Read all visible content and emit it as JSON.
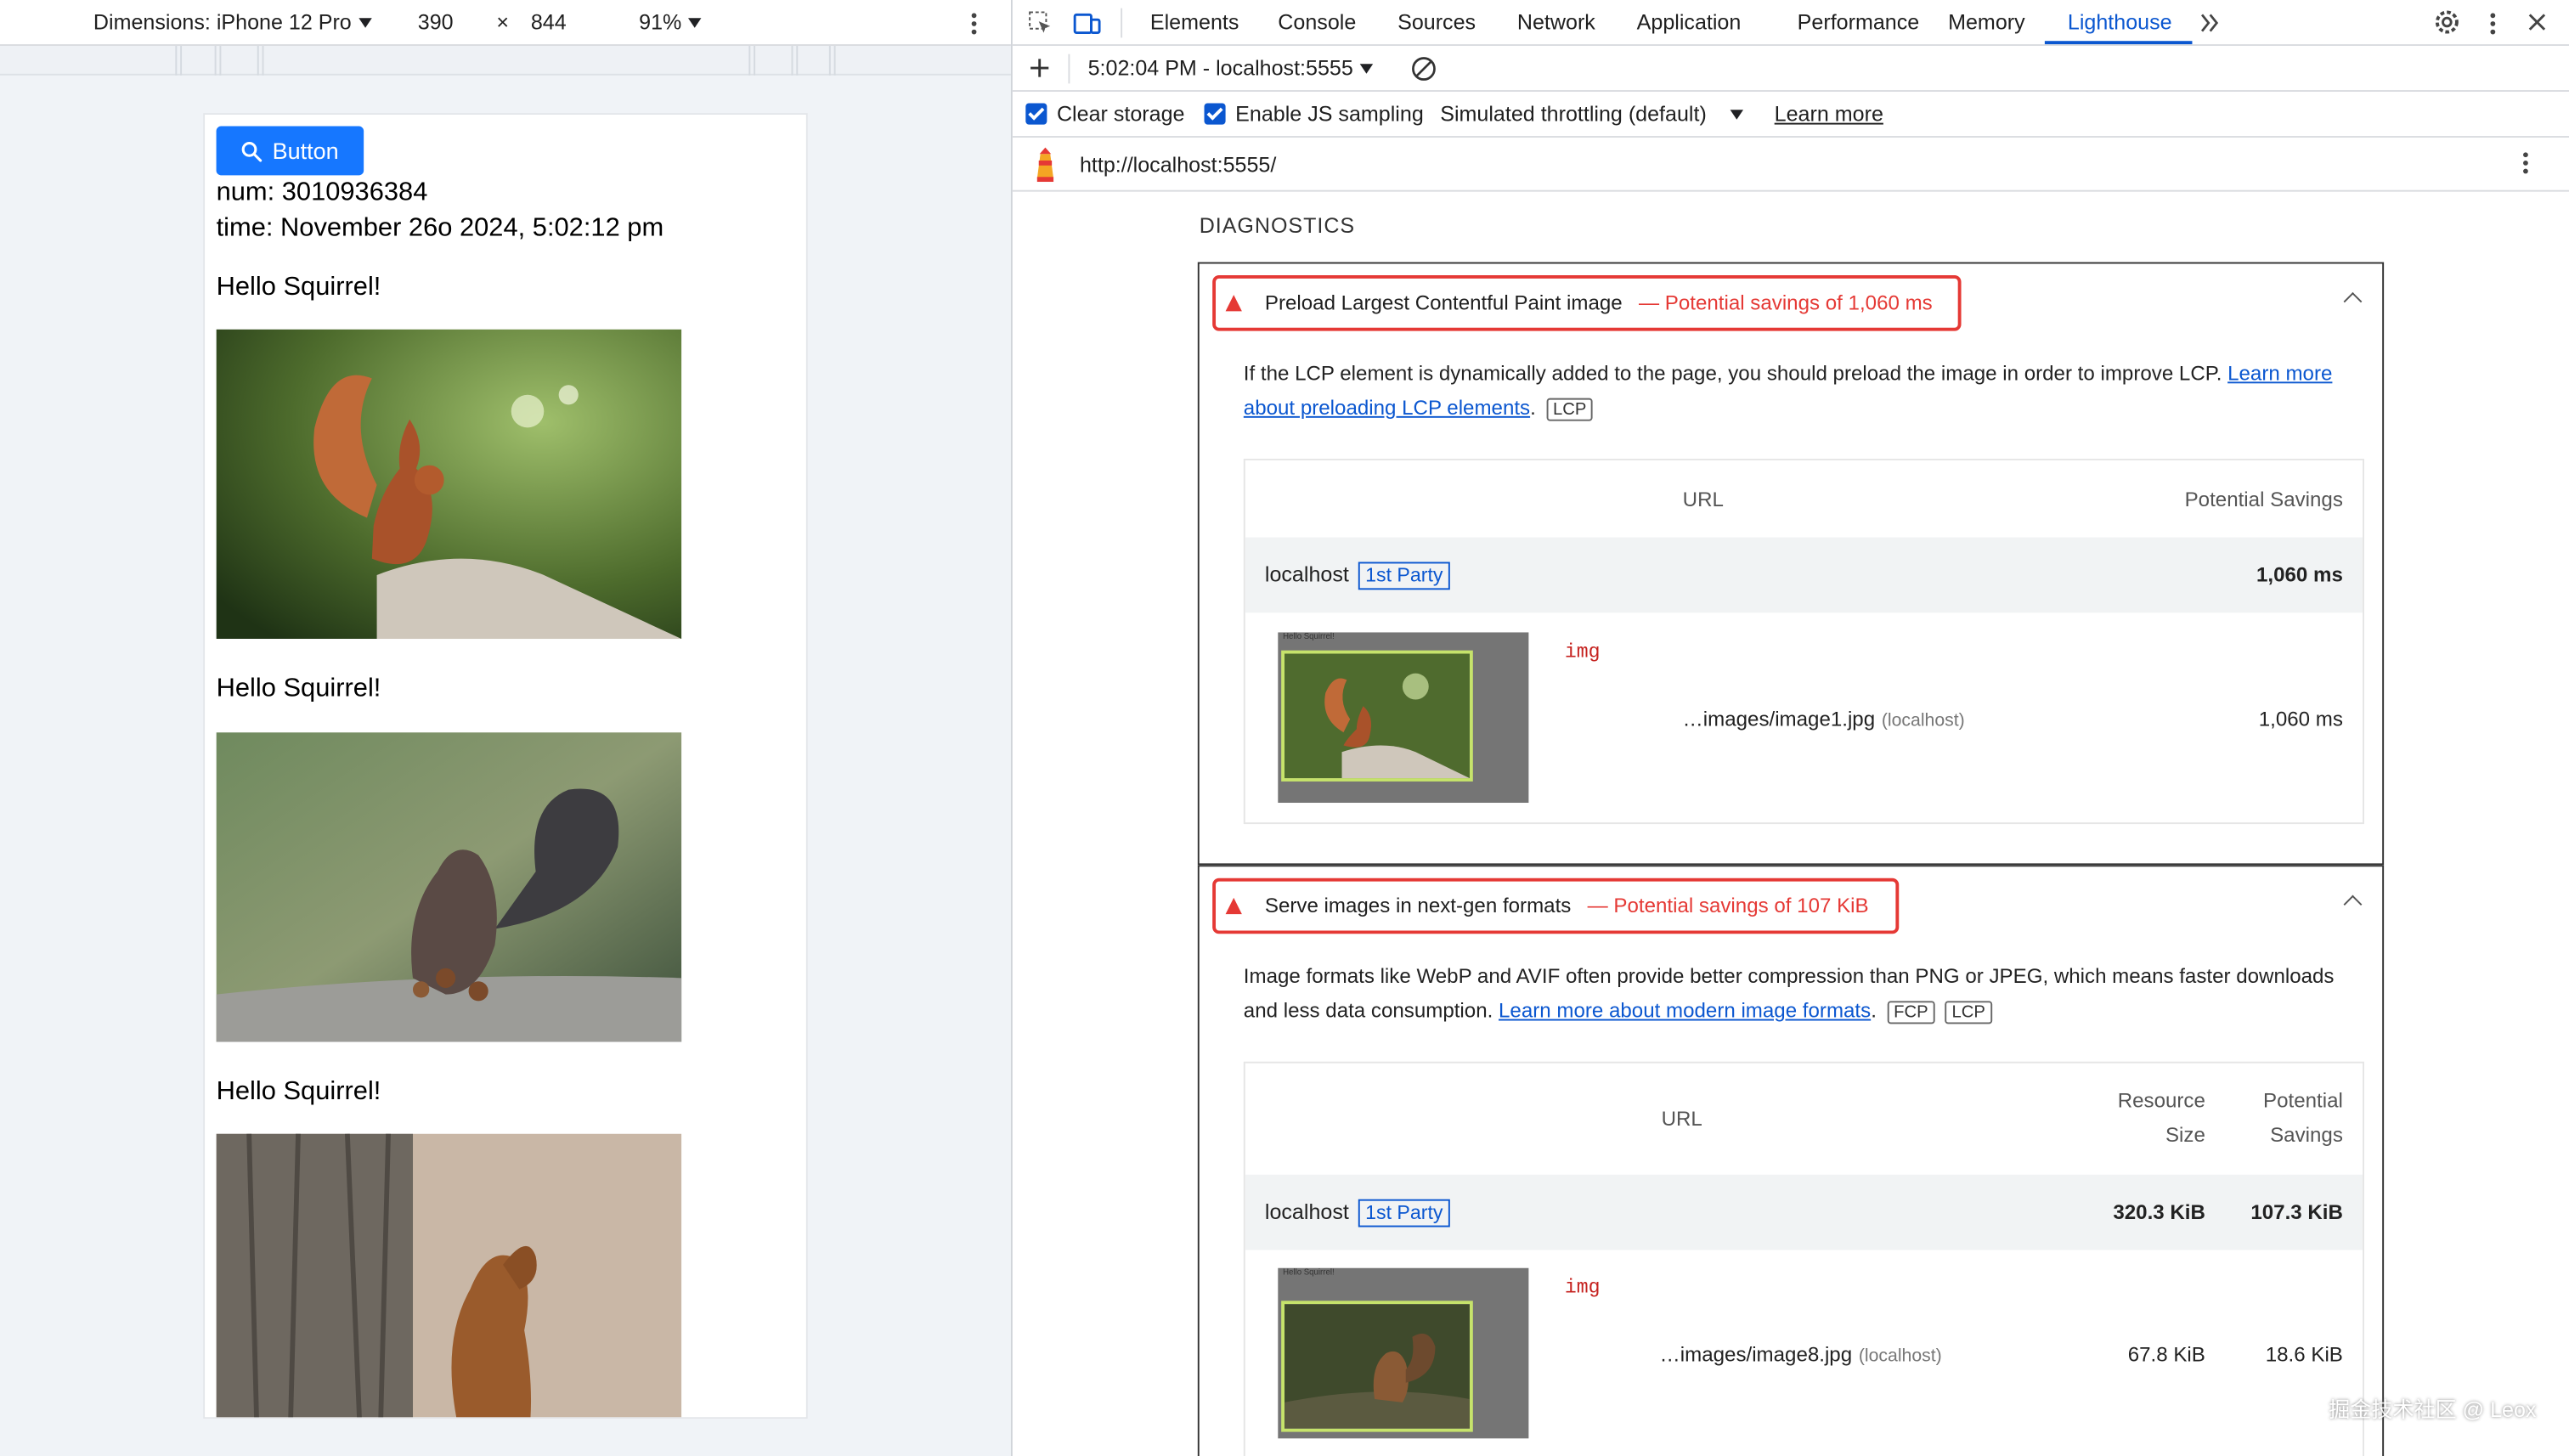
{
  "device_toolbar": {
    "dimensions_label": "Dimensions: iPhone 12 Pro",
    "width": "390",
    "times": "×",
    "height": "844",
    "zoom": "91%"
  },
  "page": {
    "button_label": "Button",
    "num_line": "num: 3010936384",
    "time_line": "time: November 26o 2024, 5:02:12 pm",
    "greeting": "Hello Squirrel!"
  },
  "devtools": {
    "tabs": [
      "Elements",
      "Console",
      "Sources",
      "Network",
      "Application",
      "Performance",
      "Memory",
      "Lighthouse"
    ],
    "active_tab": "Lighthouse",
    "report_selector": "5:02:04 PM - localhost:5555",
    "clear_storage": "Clear storage",
    "js_sampling": "Enable JS sampling",
    "throttling": "Simulated throttling (default)",
    "learn_more": "Learn more",
    "url": "http://localhost:5555/"
  },
  "report": {
    "section_title": "DIAGNOSTICS",
    "audits": [
      {
        "title": "Preload Largest Contentful Paint image",
        "savings": "— Potential savings of 1,060 ms",
        "description_text": "If the LCP element is dynamically added to the page, you should preload the image in order to improve LCP. ",
        "description_link": "Learn more about preloading LCP elements",
        "chips": [
          "LCP"
        ],
        "col_url": "URL",
        "col_savings": "Potential Savings",
        "host": "localhost",
        "party": "1st Party",
        "host_savings": "1,060 ms",
        "item_tag": "img",
        "item_url": "…images/image1.jpg",
        "item_host": "(localhost)",
        "item_savings": "1,060 ms",
        "thumb_caption": "Hello Squirrel!"
      },
      {
        "title": "Serve images in next-gen formats",
        "savings": "— Potential savings of 107 KiB",
        "description_text": "Image formats like WebP and AVIF often provide better compression than PNG or JPEG, which means faster downloads and less data consumption. ",
        "description_link": "Learn more about modern image formats",
        "chips": [
          "FCP",
          "LCP"
        ],
        "col_url": "URL",
        "col_size_1": "Resource",
        "col_size_2": "Size",
        "col_savings_1": "Potential",
        "col_savings_2": "Savings",
        "host": "localhost",
        "party": "1st Party",
        "host_size": "320.3 KiB",
        "host_savings": "107.3 KiB",
        "item_tag": "img",
        "item_url": "…images/image8.jpg",
        "item_host": "(localhost)",
        "item_size": "67.8 KiB",
        "item_savings": "18.6 KiB",
        "thumb_caption": "Hello Squirrel!"
      }
    ]
  },
  "watermark": "掘金技术社区 @ Leox",
  "colors": {
    "accent": "#0b57d0",
    "warning": "#e53935",
    "button": "#1677ff"
  }
}
